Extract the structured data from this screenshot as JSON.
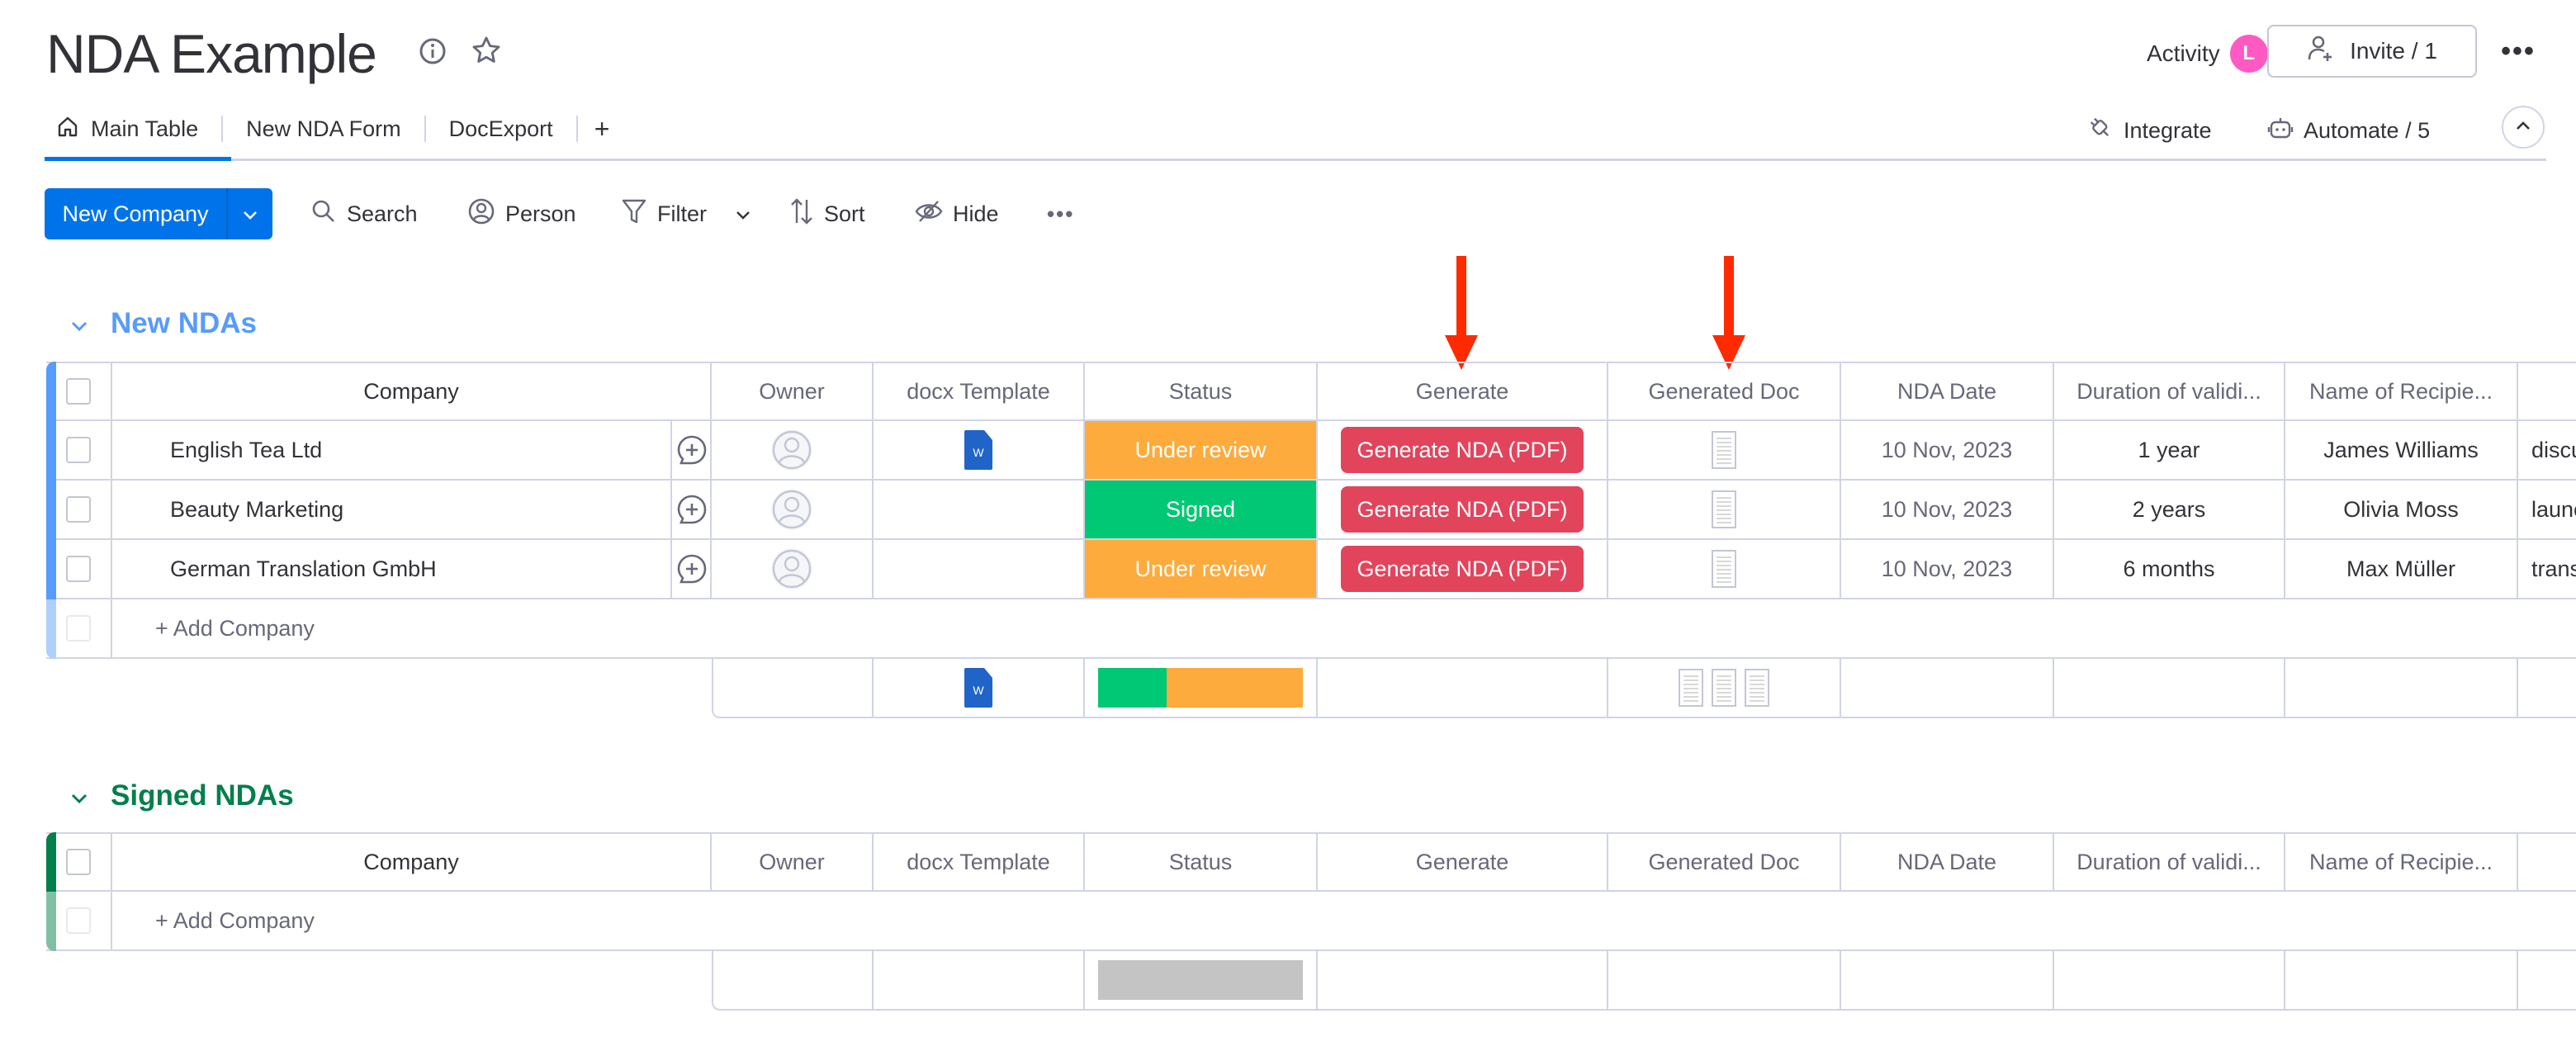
{
  "header": {
    "title": "NDA Example",
    "activity_label": "Activity",
    "activity_avatar_initial": "L",
    "invite_label": "Invite / 1"
  },
  "tabs": [
    {
      "label": "Main Table",
      "active": true
    },
    {
      "label": "New NDA Form",
      "active": false
    },
    {
      "label": "DocExport",
      "active": false
    }
  ],
  "tabs_add": "+",
  "right_actions": {
    "integrate": "Integrate",
    "automate": "Automate / 5"
  },
  "toolbar": {
    "new_item": "New Company",
    "search": "Search",
    "person": "Person",
    "filter": "Filter",
    "sort": "Sort",
    "hide": "Hide"
  },
  "columns": [
    "Company",
    "Owner",
    "docx Template",
    "Status",
    "Generate",
    "Generated Doc",
    "NDA Date",
    "Duration of validi...",
    "Name of Recipie...",
    ""
  ],
  "colors": {
    "accent": "#0073ea",
    "group_new": "#579bfc",
    "group_signed": "#037f4c",
    "status_under_review": "#fdab3d",
    "status_signed": "#00c875",
    "generate_button": "#e2445c",
    "annotation_arrow": "#ff2a00",
    "empty_status": "#c4c4c4"
  },
  "groups": [
    {
      "title": "New NDAs",
      "add_label": "+ Add Company",
      "rows": [
        {
          "company": "English Tea Ltd",
          "has_template": true,
          "status": "Under review",
          "generate": "Generate NDA (PDF)",
          "nda_date": "10 Nov, 2023",
          "duration": "1 year",
          "recipient": "James Williams",
          "extra": "discus"
        },
        {
          "company": "Beauty Marketing",
          "has_template": false,
          "status": "Signed",
          "generate": "Generate NDA (PDF)",
          "nda_date": "10 Nov, 2023",
          "duration": "2 years",
          "recipient": "Olivia Moss",
          "extra": "launcl"
        },
        {
          "company": "German Translation GmbH",
          "has_template": false,
          "status": "Under review",
          "generate": "Generate NDA (PDF)",
          "nda_date": "10 Nov, 2023",
          "duration": "6 months",
          "recipient": "Max Müller",
          "extra": "transl"
        }
      ],
      "summary": {
        "status_distribution": {
          "Signed": 1,
          "Under review": 2
        },
        "generated_docs": 3
      }
    },
    {
      "title": "Signed NDAs",
      "add_label": "+ Add Company",
      "rows": [],
      "summary": {
        "status_distribution": {}
      }
    }
  ]
}
